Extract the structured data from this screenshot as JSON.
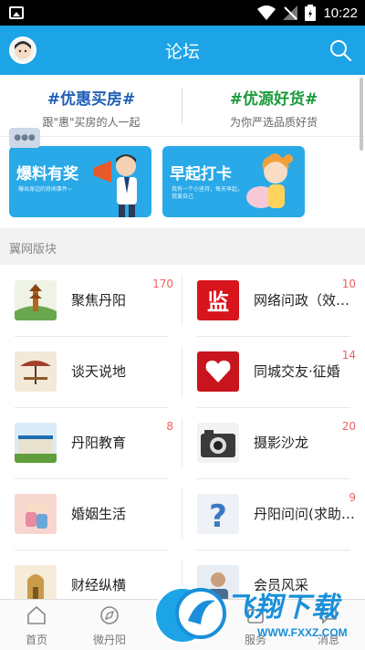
{
  "status_bar": {
    "time": "10:22"
  },
  "header": {
    "title": "论坛"
  },
  "promo": {
    "left": {
      "tag": "#优惠买房#",
      "sub": "跟\"惠\"买房的人一起",
      "color": "#1f5fb5"
    },
    "right": {
      "tag": "#优源好货#",
      "sub": "为你严选品质好货",
      "color": "#1a9a3c"
    }
  },
  "banners": [
    {
      "title": "爆料有奖",
      "sub": "爆出身边的奇闻事件~"
    },
    {
      "title": "早起打卡",
      "sub": "我有一个小坚持，每天早起，我爱自己"
    }
  ],
  "section": {
    "title": "翼网版块"
  },
  "forums": [
    {
      "name": "聚焦丹阳",
      "count": "170",
      "icon": "pagoda-icon"
    },
    {
      "name": "网络问政（效…",
      "count": "10",
      "icon": "supervise-icon"
    },
    {
      "name": "谈天说地",
      "count": "",
      "icon": "cafe-table-icon"
    },
    {
      "name": "同城交友·征婚",
      "count": "14",
      "icon": "heart-icon"
    },
    {
      "name": "丹阳教育",
      "count": "8",
      "icon": "school-icon"
    },
    {
      "name": "摄影沙龙",
      "count": "20",
      "icon": "camera-icon"
    },
    {
      "name": "婚姻生活",
      "count": "",
      "icon": "couple-icon"
    },
    {
      "name": "丹阳问问(求助…",
      "count": "9",
      "icon": "question-icon"
    },
    {
      "name": "财经纵横",
      "count": "",
      "icon": "building-icon"
    },
    {
      "name": "会员风采",
      "count": "",
      "icon": "member-icon"
    }
  ],
  "tabs": [
    {
      "label": "首页",
      "icon": "home-icon"
    },
    {
      "label": "微丹阳",
      "icon": "compass-icon"
    },
    {
      "label": "服务",
      "icon": "service-icon"
    },
    {
      "label": "消息",
      "icon": "message-icon"
    }
  ],
  "watermark": {
    "text": "飞翔下载",
    "url": "WWW.FXXZ.COM"
  }
}
